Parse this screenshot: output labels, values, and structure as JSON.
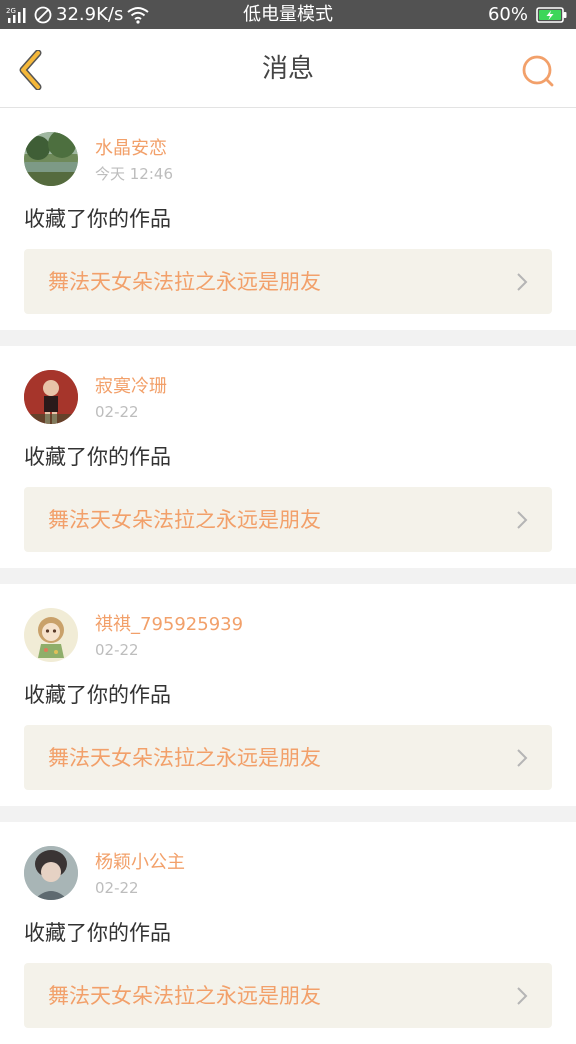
{
  "status_bar": {
    "network_label": "2G",
    "speed": "32.9K/s",
    "mode": "低电量模式",
    "battery": "60%"
  },
  "nav": {
    "title": "消息"
  },
  "messages": [
    {
      "username": "水晶安恋",
      "time": "今天 12:46",
      "action": "收藏了你的作品",
      "work_title": "舞法天女朵法拉之永远是朋友"
    },
    {
      "username": "寂寞冷珊",
      "time": "02-22",
      "action": "收藏了你的作品",
      "work_title": "舞法天女朵法拉之永远是朋友"
    },
    {
      "username": "祺祺_795925939",
      "time": "02-22",
      "action": "收藏了你的作品",
      "work_title": "舞法天女朵法拉之永远是朋友"
    },
    {
      "username": "杨颖小公主",
      "time": "02-22",
      "action": "收藏了你的作品",
      "work_title": "舞法天女朵法拉之永远是朋友"
    }
  ],
  "colors": {
    "accent": "#f2a06a",
    "back_arrow": "#f5b83a",
    "status_bar_bg": "#525252",
    "battery_fill": "#3dd65a",
    "work_link_bg": "#f4f2ea"
  }
}
